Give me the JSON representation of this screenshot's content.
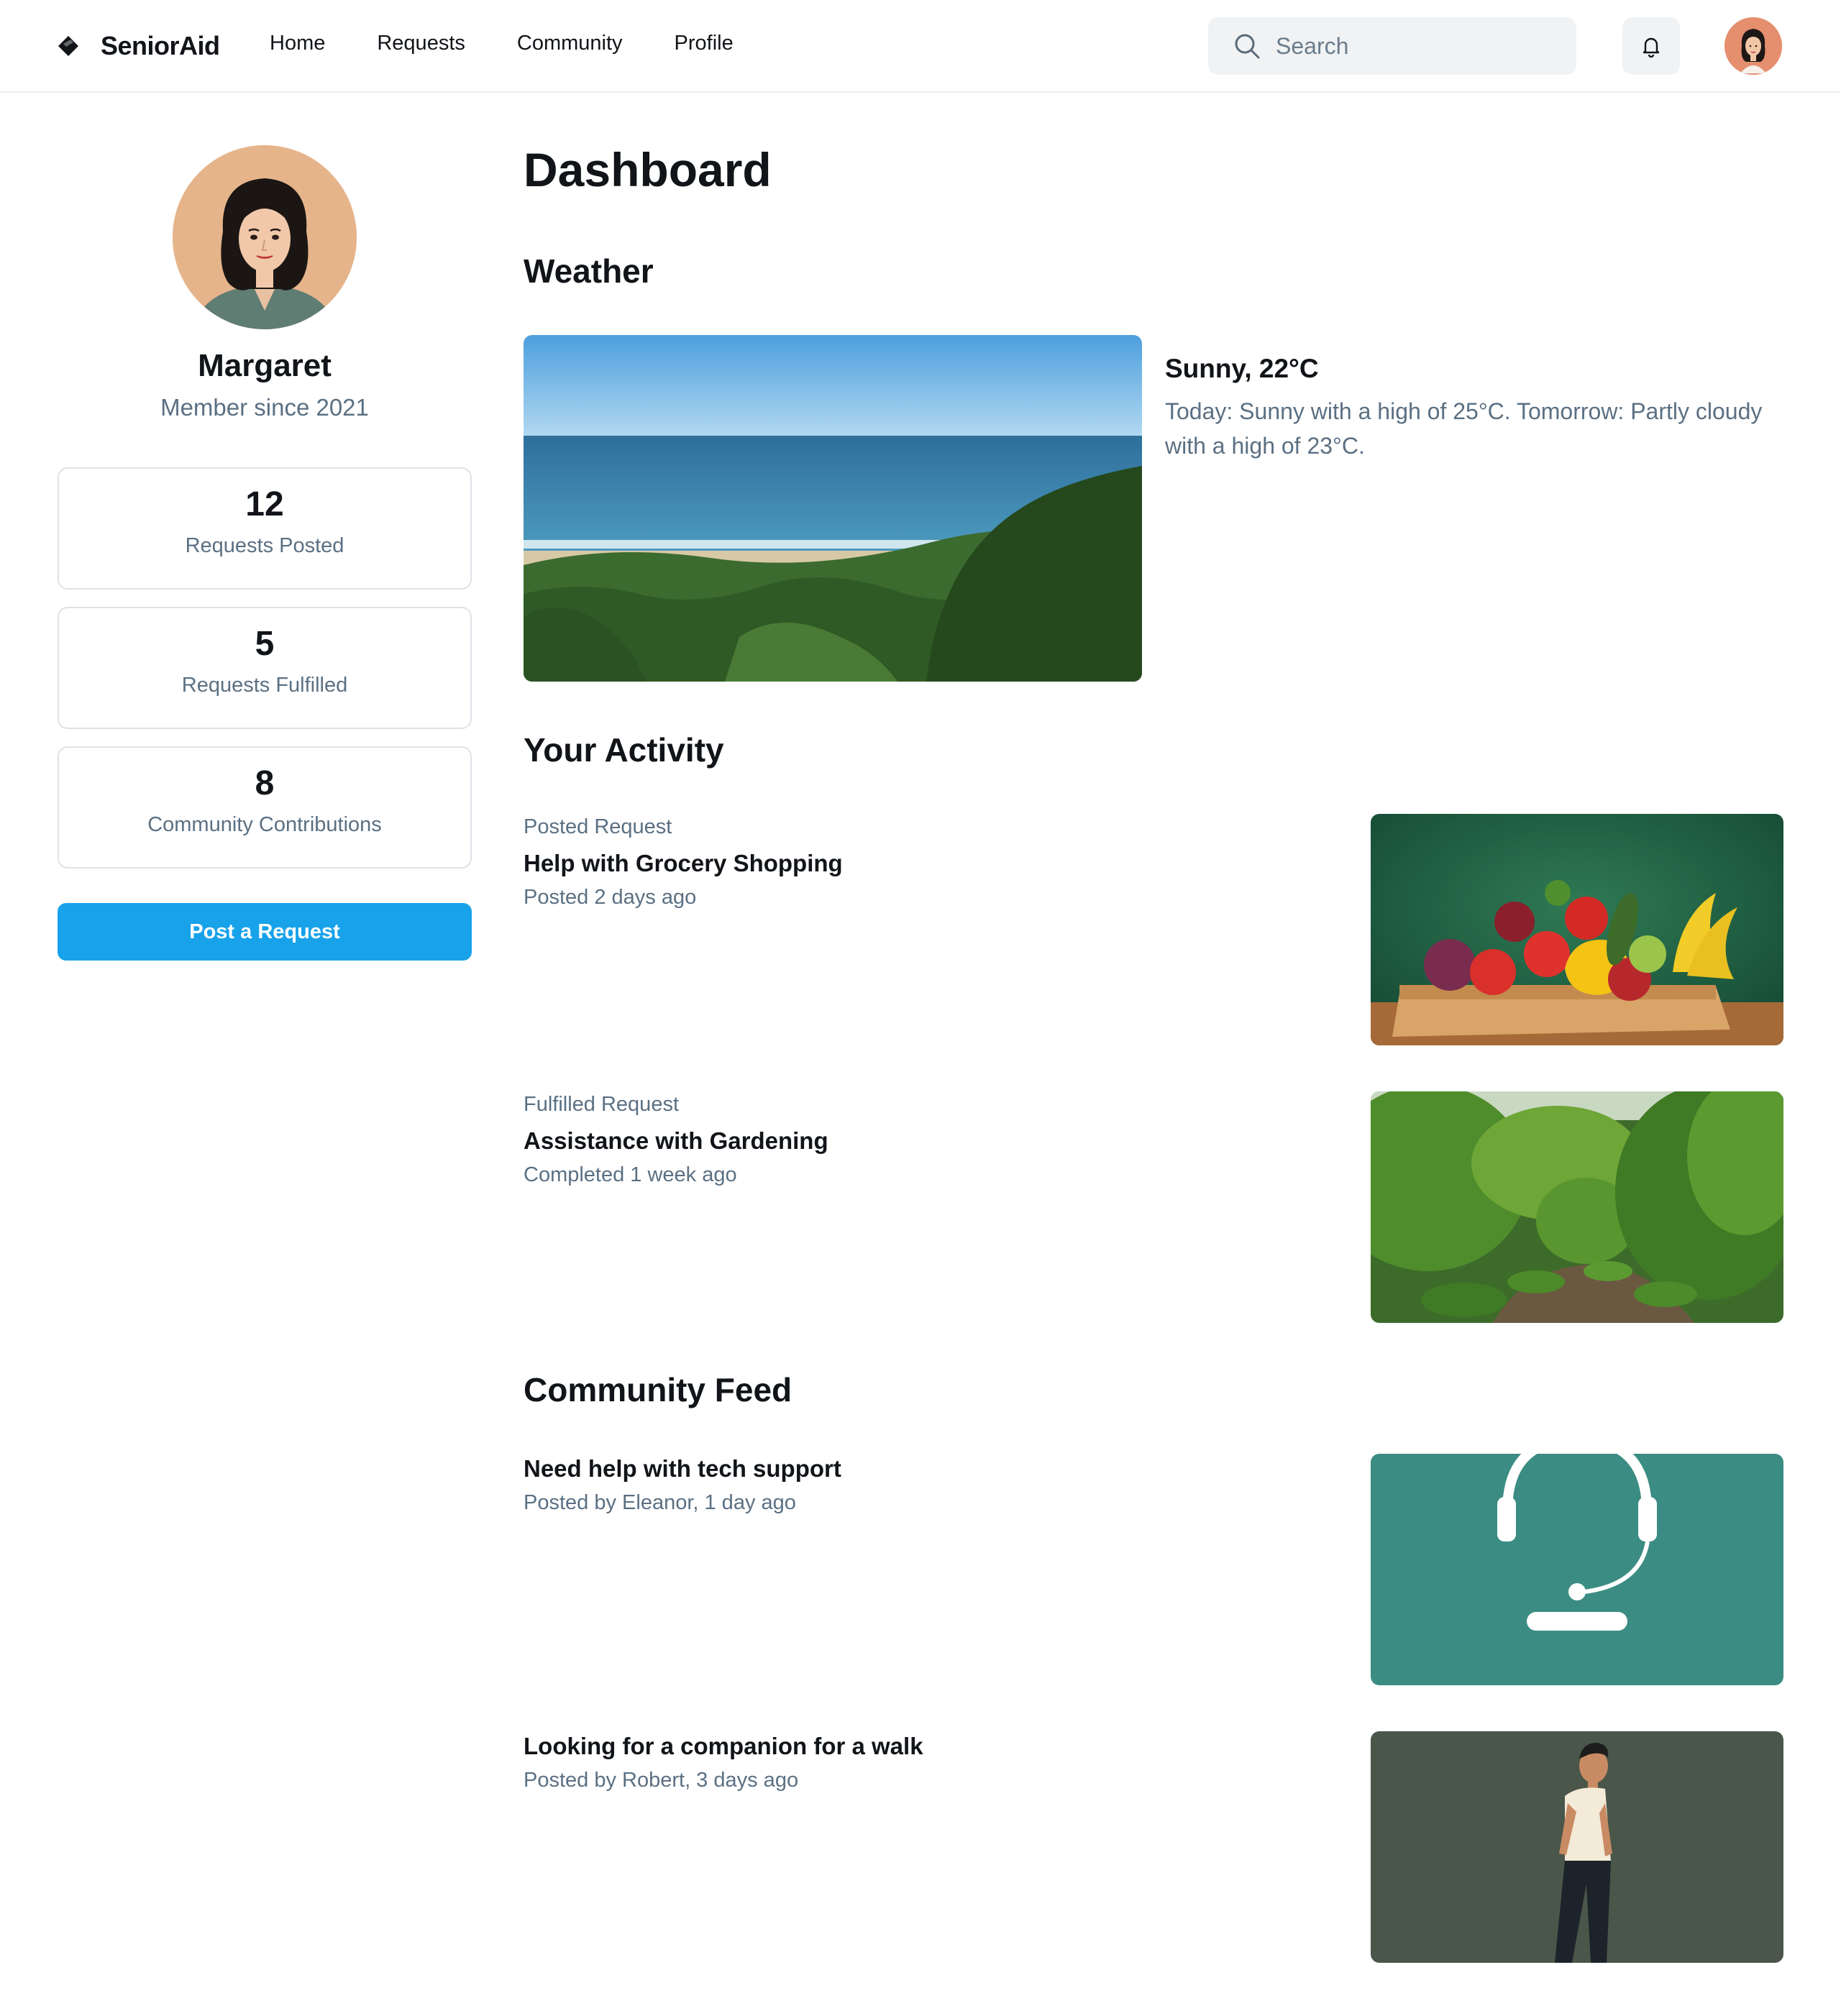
{
  "app": {
    "name": "SeniorAid"
  },
  "nav": {
    "items": [
      {
        "label": "Home"
      },
      {
        "label": "Requests"
      },
      {
        "label": "Community"
      },
      {
        "label": "Profile"
      }
    ]
  },
  "search": {
    "placeholder": "Search"
  },
  "icons": {
    "logo": "diamond-logo-icon",
    "search": "search-icon",
    "notifications": "bell-icon"
  },
  "user": {
    "name": "Margaret",
    "member_since": "Member since 2021"
  },
  "stats": [
    {
      "value": "12",
      "label": "Requests Posted"
    },
    {
      "value": "5",
      "label": "Requests Fulfilled"
    },
    {
      "value": "8",
      "label": "Community Contributions"
    }
  ],
  "actions": {
    "post_request": "Post a Request"
  },
  "page": {
    "title": "Dashboard"
  },
  "weather": {
    "heading": "Weather",
    "title": "Sunny, 22°C",
    "description": "Today: Sunny with a high of 25°C. Tomorrow: Partly cloudy with a high of 23°C."
  },
  "activity": {
    "heading": "Your Activity",
    "items": [
      {
        "type": "Posted Request",
        "title": "Help with Grocery Shopping",
        "meta": "Posted 2 days ago"
      },
      {
        "type": "Fulfilled Request",
        "title": "Assistance with Gardening",
        "meta": "Completed 1 week ago"
      }
    ]
  },
  "feed": {
    "heading": "Community Feed",
    "items": [
      {
        "title": "Need help with tech support",
        "meta": "Posted by Eleanor, 1 day ago"
      },
      {
        "title": "Looking for a companion for a walk",
        "meta": "Posted by Robert, 3 days ago"
      }
    ]
  },
  "colors": {
    "accent": "#17a2ea",
    "muted_text": "#5b7083",
    "border": "#dde2e7",
    "surface": "#f0f2f4"
  }
}
